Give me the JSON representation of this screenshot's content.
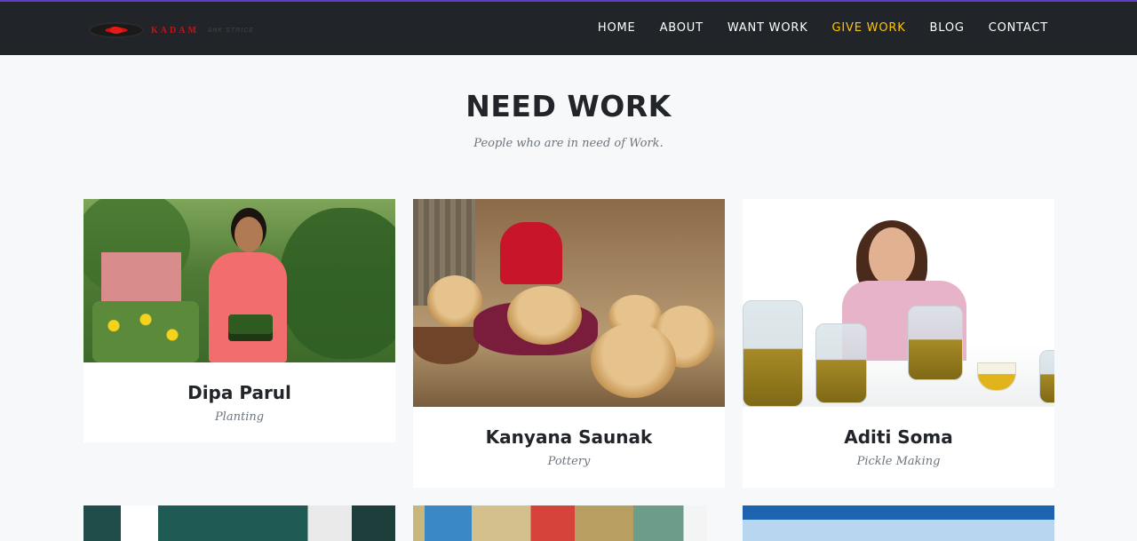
{
  "site": {
    "logo_text": "KADAM",
    "logo_tagline": "ANK STRICE"
  },
  "nav": {
    "items": [
      {
        "label": "HOME",
        "active": false
      },
      {
        "label": "ABOUT",
        "active": false
      },
      {
        "label": "WANT WORK",
        "active": false
      },
      {
        "label": "GIVE WORK",
        "active": true
      },
      {
        "label": "BLOG",
        "active": false
      },
      {
        "label": "CONTACT",
        "active": false
      }
    ]
  },
  "section": {
    "title": "NEED WORK",
    "subtitle": "People who are in need of Work."
  },
  "cards": [
    {
      "name": "Dipa Parul",
      "role": "Planting"
    },
    {
      "name": "Kanyana Saunak",
      "role": "Pottery"
    },
    {
      "name": "Aditi Soma",
      "role": "Pickle Making"
    }
  ],
  "colors": {
    "nav_bg": "#212529",
    "nav_active": "#fec503",
    "nav_top_border": "#5b3fc4",
    "page_bg": "#f7f8fa"
  }
}
